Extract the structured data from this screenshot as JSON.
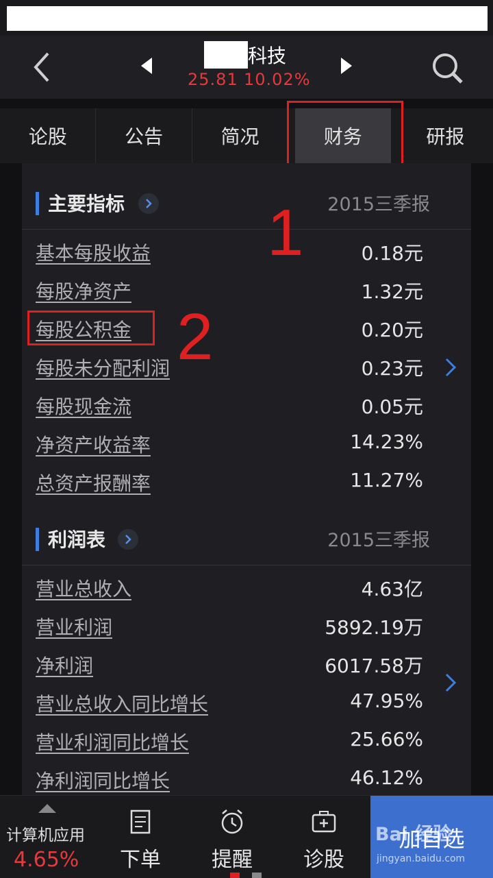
{
  "header": {
    "stock_name": "科技",
    "price": "25.81",
    "change_pct": "10.02%"
  },
  "tabs": [
    "论股",
    "公告",
    "简况",
    "财务",
    "研报"
  ],
  "main_indicators": {
    "title": "主要指标",
    "period": "2015三季报",
    "rows": [
      {
        "label": "基本每股收益",
        "value": "0.18元"
      },
      {
        "label": "每股净资产",
        "value": "1.32元"
      },
      {
        "label": "每股公积金",
        "value": "0.20元"
      },
      {
        "label": "每股未分配利润",
        "value": "0.23元"
      },
      {
        "label": "每股现金流",
        "value": "0.05元"
      },
      {
        "label": "净资产收益率",
        "value": "14.23%"
      },
      {
        "label": "总资产报酬率",
        "value": "11.27%"
      }
    ]
  },
  "income": {
    "title": "利润表",
    "period": "2015三季报",
    "rows": [
      {
        "label": "营业总收入",
        "value": "4.63亿"
      },
      {
        "label": "营业利润",
        "value": "5892.19万"
      },
      {
        "label": "净利润",
        "value": "6017.58万"
      },
      {
        "label": "营业总收入同比增长",
        "value": "47.95%"
      },
      {
        "label": "营业利润同比增长",
        "value": "25.66%"
      },
      {
        "label": "净利润同比增长",
        "value": "46.12%"
      }
    ]
  },
  "annotations": {
    "one": "1",
    "two": "2"
  },
  "bottom": {
    "sector_name": "计算机应用",
    "sector_change": "4.65%",
    "order": "下单",
    "remind": "提醒",
    "diagnose": "诊股",
    "add_watch": "加自选"
  },
  "watermark": {
    "brand": "Bai 经验",
    "url": "jingyan.baidu.com"
  },
  "colors": {
    "up": "#e8383b",
    "accent": "#3d7fe0",
    "annotation": "#e02020"
  }
}
